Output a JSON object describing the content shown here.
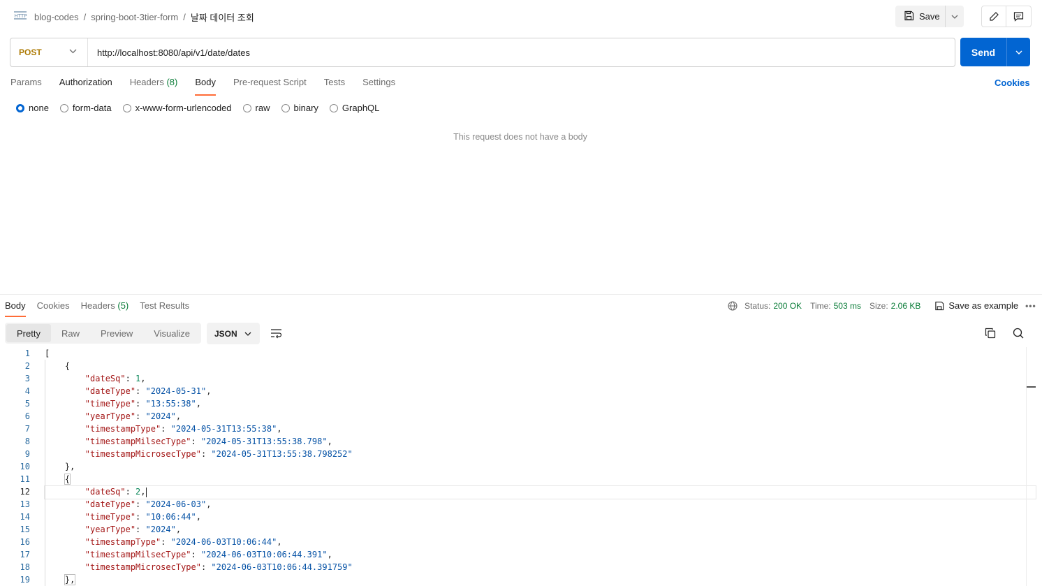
{
  "breadcrumb": {
    "items": [
      "blog-codes",
      "spring-boot-3tier-form"
    ],
    "current": "날짜 데이터 조회",
    "separator": "/"
  },
  "header": {
    "save_label": "Save"
  },
  "request": {
    "method": "POST",
    "url": "http://localhost:8080/api/v1/date/dates",
    "send_label": "Send"
  },
  "request_tabs": {
    "params": "Params",
    "authorization": "Authorization",
    "headers": "Headers",
    "headers_count": "(8)",
    "body": "Body",
    "prerequest": "Pre-request Script",
    "tests": "Tests",
    "settings": "Settings",
    "cookies": "Cookies"
  },
  "body_modes": {
    "none": "none",
    "form_data": "form-data",
    "urlencoded": "x-www-form-urlencoded",
    "raw": "raw",
    "binary": "binary",
    "graphql": "GraphQL",
    "selected": "none"
  },
  "no_body_message": "This request does not have a body",
  "response_tabs": {
    "body": "Body",
    "cookies": "Cookies",
    "headers": "Headers",
    "headers_count": "(5)",
    "test_results": "Test Results"
  },
  "response_meta": {
    "status_label": "Status:",
    "status_value": "200 OK",
    "time_label": "Time:",
    "time_value": "503 ms",
    "size_label": "Size:",
    "size_value": "2.06 KB",
    "save_example": "Save as example",
    "more": "•••"
  },
  "view_modes": {
    "pretty": "Pretty",
    "raw": "Raw",
    "preview": "Preview",
    "visualize": "Visualize",
    "format": "JSON"
  },
  "code": {
    "lines": [
      {
        "no": "1",
        "indent": "",
        "key": "",
        "value": "",
        "type": "",
        "text": "["
      },
      {
        "no": "2",
        "indent": "    ",
        "key": "",
        "value": "",
        "type": "",
        "text": "{"
      },
      {
        "no": "3",
        "indent": "        ",
        "key": "\"dateSq\"",
        "value": "1",
        "type": "n",
        "text": ","
      },
      {
        "no": "4",
        "indent": "        ",
        "key": "\"dateType\"",
        "value": "\"2024-05-31\"",
        "type": "s",
        "text": ","
      },
      {
        "no": "5",
        "indent": "        ",
        "key": "\"timeType\"",
        "value": "\"13:55:38\"",
        "type": "s",
        "text": ","
      },
      {
        "no": "6",
        "indent": "        ",
        "key": "\"yearType\"",
        "value": "\"2024\"",
        "type": "s",
        "text": ","
      },
      {
        "no": "7",
        "indent": "        ",
        "key": "\"timestampType\"",
        "value": "\"2024-05-31T13:55:38\"",
        "type": "s",
        "text": ","
      },
      {
        "no": "8",
        "indent": "        ",
        "key": "\"timestampMilsecType\"",
        "value": "\"2024-05-31T13:55:38.798\"",
        "type": "s",
        "text": ","
      },
      {
        "no": "9",
        "indent": "        ",
        "key": "\"timestampMicrosecType\"",
        "value": "\"2024-05-31T13:55:38.798252\"",
        "type": "s",
        "text": ""
      },
      {
        "no": "10",
        "indent": "    ",
        "key": "",
        "value": "",
        "type": "",
        "text": "},"
      },
      {
        "no": "11",
        "indent": "    ",
        "key": "",
        "value": "",
        "type": "box",
        "text": "{"
      },
      {
        "no": "12",
        "indent": "        ",
        "key": "\"dateSq\"",
        "value": "2",
        "type": "n",
        "text": ",",
        "current": true
      },
      {
        "no": "13",
        "indent": "        ",
        "key": "\"dateType\"",
        "value": "\"2024-06-03\"",
        "type": "s",
        "text": ","
      },
      {
        "no": "14",
        "indent": "        ",
        "key": "\"timeType\"",
        "value": "\"10:06:44\"",
        "type": "s",
        "text": ","
      },
      {
        "no": "15",
        "indent": "        ",
        "key": "\"yearType\"",
        "value": "\"2024\"",
        "type": "s",
        "text": ","
      },
      {
        "no": "16",
        "indent": "        ",
        "key": "\"timestampType\"",
        "value": "\"2024-06-03T10:06:44\"",
        "type": "s",
        "text": ","
      },
      {
        "no": "17",
        "indent": "        ",
        "key": "\"timestampMilsecType\"",
        "value": "\"2024-06-03T10:06:44.391\"",
        "type": "s",
        "text": ","
      },
      {
        "no": "18",
        "indent": "        ",
        "key": "\"timestampMicrosecType\"",
        "value": "\"2024-06-03T10:06:44.391759\"",
        "type": "s",
        "text": ""
      },
      {
        "no": "19",
        "indent": "    ",
        "key": "",
        "value": "",
        "type": "box",
        "text": "},"
      }
    ]
  },
  "colors": {
    "accent_tab": "#ff6c37",
    "send_button": "#0265d2",
    "method_post": "#ad7a03",
    "status_ok": "#0a7c38",
    "json_key": "#a31515",
    "json_string": "#0451a5",
    "json_number": "#098658"
  }
}
